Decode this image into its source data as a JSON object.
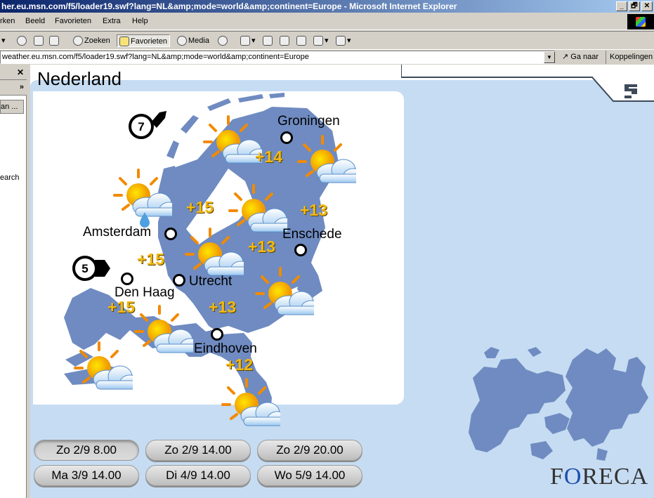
{
  "window": {
    "title": "her.eu.msn.com/f5/loader19.swf?lang=NL&amp;mode=world&amp;continent=Europe - Microsoft Internet Explorer",
    "min_label": "_",
    "max_label": "🗗",
    "close_label": "✕"
  },
  "menu": [
    "rken",
    "Beeld",
    "Favorieten",
    "Extra",
    "Help"
  ],
  "toolbar": {
    "search_label": "Zoeken",
    "favorites_label": "Favorieten",
    "media_label": "Media"
  },
  "address": {
    "url": "weather.eu.msn.com/f5/loader19.swf?lang=NL&amp;mode=world&amp;continent=Europe",
    "go_label": "Ga naar",
    "links_label": "Koppelingen"
  },
  "left_panel": {
    "close": "✕",
    "chevron": "»",
    "item_label": "an ...",
    "search_text": "earch"
  },
  "weather": {
    "country": "Nederland",
    "cities": [
      {
        "name": "Groningen"
      },
      {
        "name": "Amsterdam"
      },
      {
        "name": "Enschede"
      },
      {
        "name": "Utrecht"
      },
      {
        "name": "Den Haag"
      },
      {
        "name": "Eindhoven"
      }
    ],
    "temps": [
      "+14",
      "+15",
      "+13",
      "+15",
      "+13",
      "+15",
      "+13",
      "+12"
    ],
    "wind": [
      {
        "speed": "7"
      },
      {
        "speed": "5"
      }
    ],
    "dates": [
      "Zo 2/9 8.00",
      "Zo 2/9 14.00",
      "Zo 2/9 20.00",
      "Ma 3/9 14.00",
      "Di 4/9 14.00",
      "Wo 5/9 14.00"
    ],
    "active_date": 0,
    "brand": {
      "f": "F",
      "o": "O",
      "rest": "RECA"
    }
  },
  "colors": {
    "land": "#6f8bc1",
    "panel": "#c6dcf2",
    "temp": "#f2b90f",
    "titlebar": "#0a246a"
  }
}
